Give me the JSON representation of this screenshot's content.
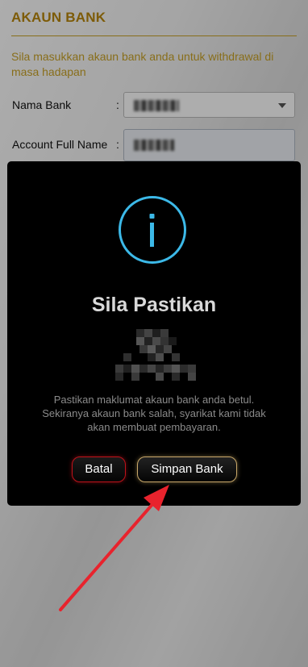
{
  "form": {
    "title": "AKAUN BANK",
    "instruction": "Sila masukkan akaun bank anda untuk withdrawal di masa hadapan",
    "bank_label": "Nama Bank",
    "account_name_label": "Account Full Name",
    "colon": ":"
  },
  "dialog": {
    "icon": "info-icon",
    "title": "Sila Pastikan",
    "message": "Pastikan maklumat akaun bank anda betul. Sekiranya akaun bank salah, syarikat kami tidak akan membuat pembayaran.",
    "cancel_label": "Batal",
    "save_label": "Simpan Bank"
  },
  "colors": {
    "accent": "#c9a227",
    "dialog_bg": "#000000",
    "icon_ring": "#3cb9e8",
    "cancel_border": "#c0121a",
    "save_border": "#c9a86a",
    "arrow": "#e8232d"
  }
}
